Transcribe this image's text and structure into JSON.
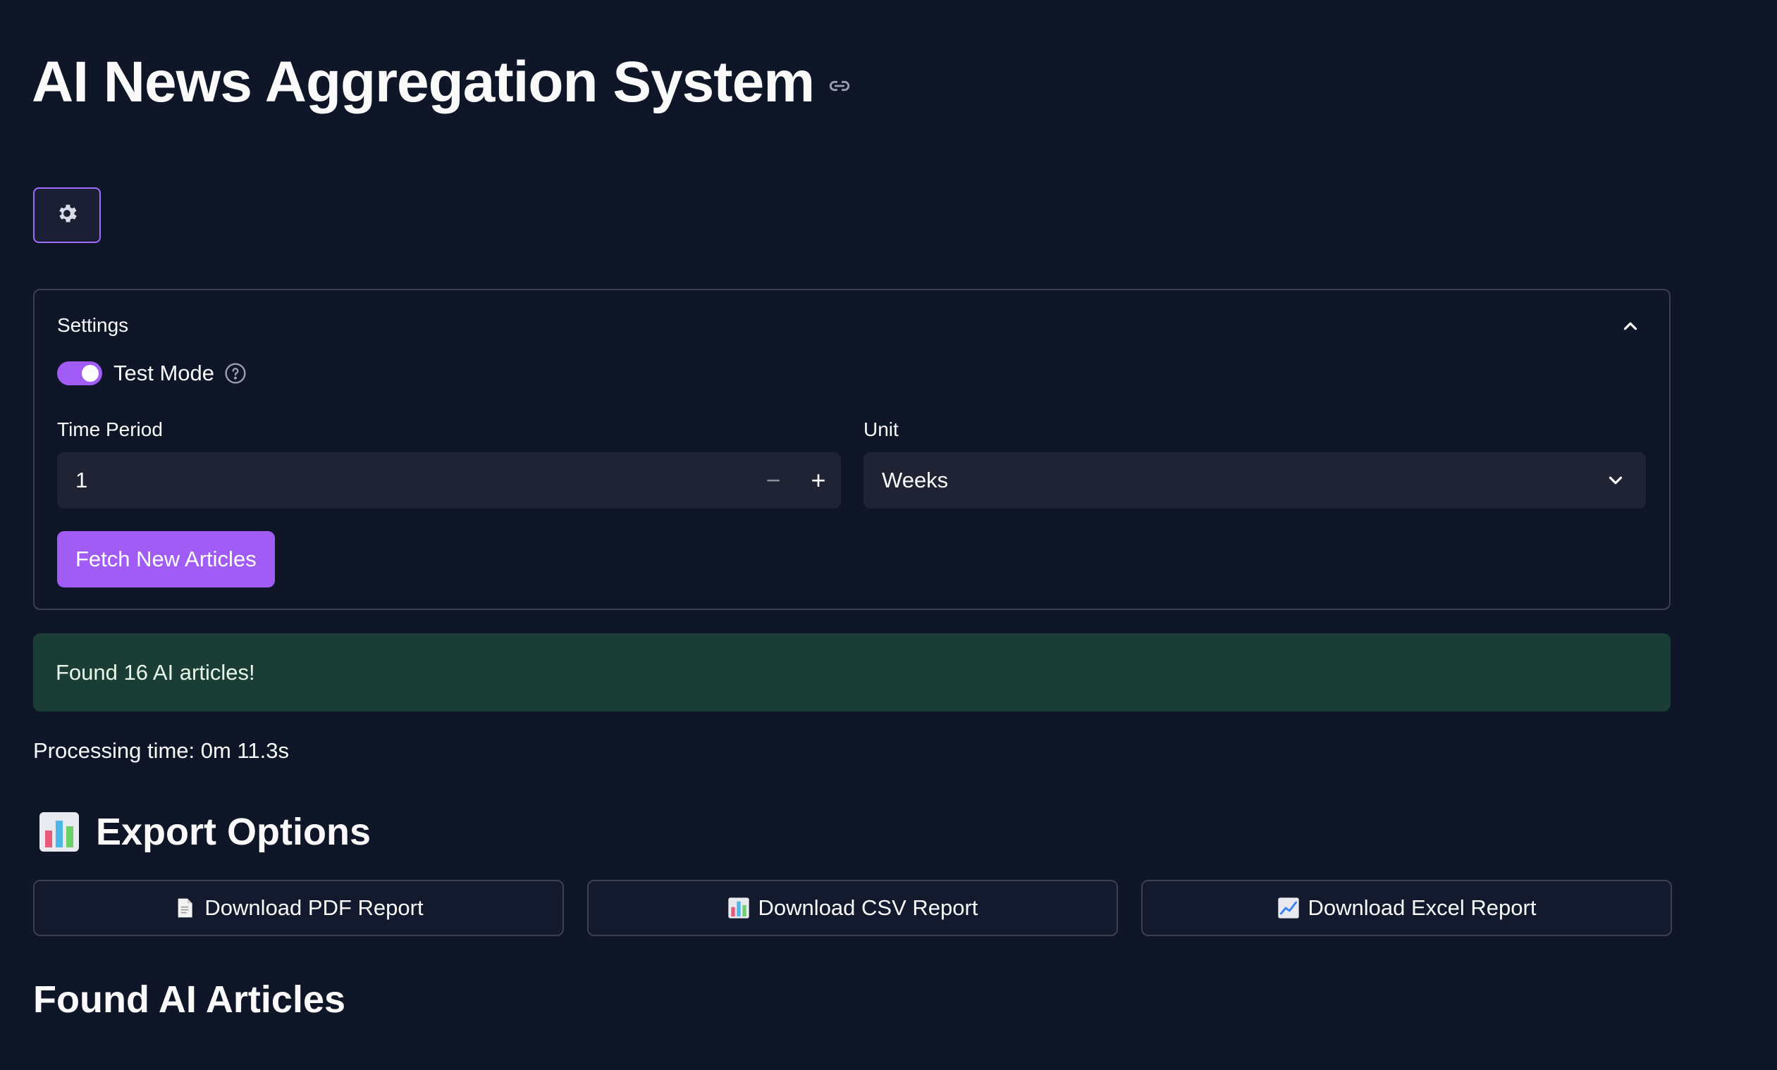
{
  "header": {
    "title": "AI News Aggregation System"
  },
  "settings_button": {
    "icon": "gear-icon"
  },
  "settings": {
    "header": "Settings",
    "test_mode": {
      "label": "Test Mode",
      "enabled": true
    },
    "time_period": {
      "label": "Time Period",
      "value": "1",
      "minus": "−",
      "plus": "+"
    },
    "unit": {
      "label": "Unit",
      "value": "Weeks"
    },
    "fetch_button": "Fetch New Articles"
  },
  "status": {
    "success_message": "Found 16 AI articles!",
    "processing_time": "Processing time: 0m 11.3s"
  },
  "export": {
    "title": "Export Options",
    "pdf": "Download PDF Report",
    "csv": "Download CSV Report",
    "excel": "Download Excel Report"
  },
  "articles": {
    "title": "Found AI Articles"
  },
  "colors": {
    "background": "#0f1628",
    "accent": "#a25cf6",
    "success_bg": "#1a3d35",
    "input_bg": "#1f2333"
  }
}
